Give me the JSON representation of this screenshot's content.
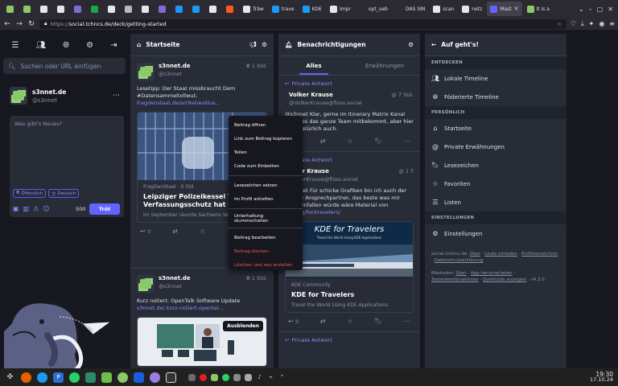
{
  "browser": {
    "tabs": [
      {
        "title": "",
        "color": "#8ac86a"
      },
      {
        "title": "",
        "color": "#8ac86a"
      },
      {
        "title": "",
        "color": "#e6e6ea"
      },
      {
        "title": "",
        "color": "#e6e6ea"
      },
      {
        "title": "",
        "color": "#7d6bd4"
      },
      {
        "title": "",
        "color": "#1fa34a"
      },
      {
        "title": "",
        "color": "#e6e6ea"
      },
      {
        "title": "",
        "color": "#b8b8b8"
      },
      {
        "title": "",
        "color": "#e6e6ea"
      },
      {
        "title": "",
        "color": "#7d6bd4"
      },
      {
        "title": "",
        "color": "#1d99f3"
      },
      {
        "title": "",
        "color": "#1d99f3"
      },
      {
        "title": "",
        "color": "#e6e6ea"
      },
      {
        "title": "",
        "color": "#ff5722"
      },
      {
        "title": "Träw",
        "color": "#e6e6ea"
      },
      {
        "title": "trave",
        "color": "#1d99f3"
      },
      {
        "title": "KDE",
        "color": "#1d99f3"
      },
      {
        "title": "Impr",
        "color": "#e6e6ea"
      },
      {
        "title": "opt_ueb",
        "color": "#2b2a33"
      },
      {
        "title": "DAS SIN",
        "color": "#2b2a33"
      },
      {
        "title": "scan",
        "color": "#e6e6ea"
      },
      {
        "title": "netz",
        "color": "#e6e6ea"
      },
      {
        "title": "Mast",
        "color": "#6364ff"
      },
      {
        "title": "It is a",
        "color": "#8ac86a"
      }
    ],
    "url_prefix": "https://",
    "url": "social.tchncs.de/deck/getting-started"
  },
  "compose": {
    "search_placeholder": "Suchen oder URL einfügen",
    "account_name": "s3nnet.de",
    "account_handle": "@s3nnet",
    "textarea_placeholder": "Was gibt's Neues?",
    "visibility": "Öffentlich",
    "language": "Deutsch",
    "char_count": "500",
    "toot_label": "Tröt"
  },
  "home": {
    "title": "Startseite",
    "status1": {
      "name": "s3nnet.de",
      "handle": "@s3nnet",
      "time": "1 Std.",
      "text": "Lesetipp: Der Staat missbraucht Dem #Datensammeltollwut:",
      "link": "fragdenstaat.de/artikel/exklus...",
      "card_source": "FragDenStaat · 6 Std.",
      "card_title": "Leipziger Polizeikessel Tag Verfassungsschutz hat wei",
      "card_desc": "Im September räumte Sachsens Verf",
      "reply_count": "0"
    },
    "status2": {
      "name": "s3nnet.de",
      "handle": "@s3nnet",
      "time": "1 Std.",
      "text": "Kurz notiert: OpenTalk Software Update",
      "link": "s3nnet.de/ kurz-notiert-opental...",
      "hide_label": "Ausblenden"
    }
  },
  "context_menu": {
    "items": [
      "Beitrag öffnen",
      "Link zum Beitrag kopieren",
      "Teilen",
      "Code zum Einbetten",
      "Lesezeichen setzen",
      "Im Profil anheften",
      "Unterhaltung stummschalten",
      "Beitrag bearbeiten",
      "Beitrag löschen",
      "Löschen und neu erstellen"
    ]
  },
  "notifications": {
    "title": "Benachrichtigungen",
    "tab_all": "Alles",
    "tab_mentions": "Erwähnungen",
    "reply_label": "Private Antwort",
    "n1": {
      "name": "Volker Krause",
      "handle": "@VolkerKrause@floss.social",
      "time": "7 Std.",
      "text": "@s3nnet Klar, gerne im Itinerary Matrix Kanal damit es das ganze Team mitbekommt, aber hier geht natürlich auch.",
      "reply_count": "0"
    },
    "n2": {
      "name": "Volker Krause",
      "handle": "@VolkerKrause@floss.social",
      "time": "1 T",
      "text": "@s3nnet Für schicke Grafiken bin ich auch der falsche Ansprechpartner, das beste was mir dazu einfallen würde wäre Material von",
      "link": "kde.org/for/travelers/",
      "card_img_title": "KDE for Travelers",
      "card_img_sub": "Travel the World Using KDE Applications",
      "card_source": "KDE Community",
      "card_title": "KDE for Travelers",
      "card_desc": "Travel the World Using KDE Applications",
      "reply_count": "0"
    },
    "reply_label_bottom": "Private Antwort"
  },
  "menu": {
    "title": "Auf geht's!",
    "section_discover": "ENTDECKEN",
    "local_timeline": "Lokale Timeline",
    "federated_timeline": "Föderierte Timeline",
    "section_personal": "PERSÖNLICH",
    "home": "Startseite",
    "private_mentions": "Private Erwähnungen",
    "bookmarks": "Lesezeichen",
    "favorites": "Favoriten",
    "lists": "Listen",
    "section_settings": "EINSTELLUNGEN",
    "settings": "Einstellungen",
    "footer1_prefix": "social.tchncs.de:",
    "footer1_links": [
      "Über",
      "Leute einladen",
      "Profilverzeichnis",
      "Datenschutzerklärung"
    ],
    "footer2_prefix": "Mastodon:",
    "footer2_links": [
      "Über",
      "App herunterladen",
      "Tastenkombinationen",
      "Quellcode anzeigen"
    ],
    "version": "v4.3.0"
  },
  "taskbar": {
    "time": "19:30",
    "date": "17.10.24"
  },
  "colors": {
    "accent": "#6364ff",
    "link": "#8c8dff",
    "column_bg": "#282c37",
    "app_bg": "#17171f",
    "danger": "#ff5050"
  }
}
